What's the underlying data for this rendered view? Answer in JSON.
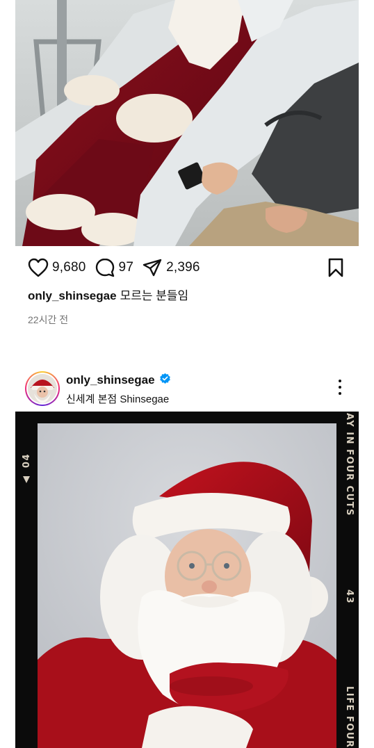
{
  "post1": {
    "like_count": "9,680",
    "comment_count": "97",
    "share_count": "2,396",
    "caption_user": "only_shinsegae",
    "caption_text": "모르는 분들임",
    "timestamp": "22시간 전"
  },
  "post2": {
    "username": "only_shinsegae",
    "location": "신세계 본점 Shinsegae",
    "frame_text_top": "AY IN FOUR CUTS",
    "frame_text_bottom": "LIFE FOUR",
    "frame_number_right": "43",
    "frame_number_left": "04"
  },
  "icons": {
    "like": "heart-icon",
    "comment": "comment-bubble-icon",
    "share": "paper-plane-icon",
    "save": "bookmark-icon",
    "verified": "verified-badge-icon",
    "more": "more-options-icon"
  },
  "colors": {
    "verified_blue": "#0095f6",
    "text_primary": "#111111",
    "text_secondary": "#737373",
    "frame_black": "#0b0b0b"
  }
}
